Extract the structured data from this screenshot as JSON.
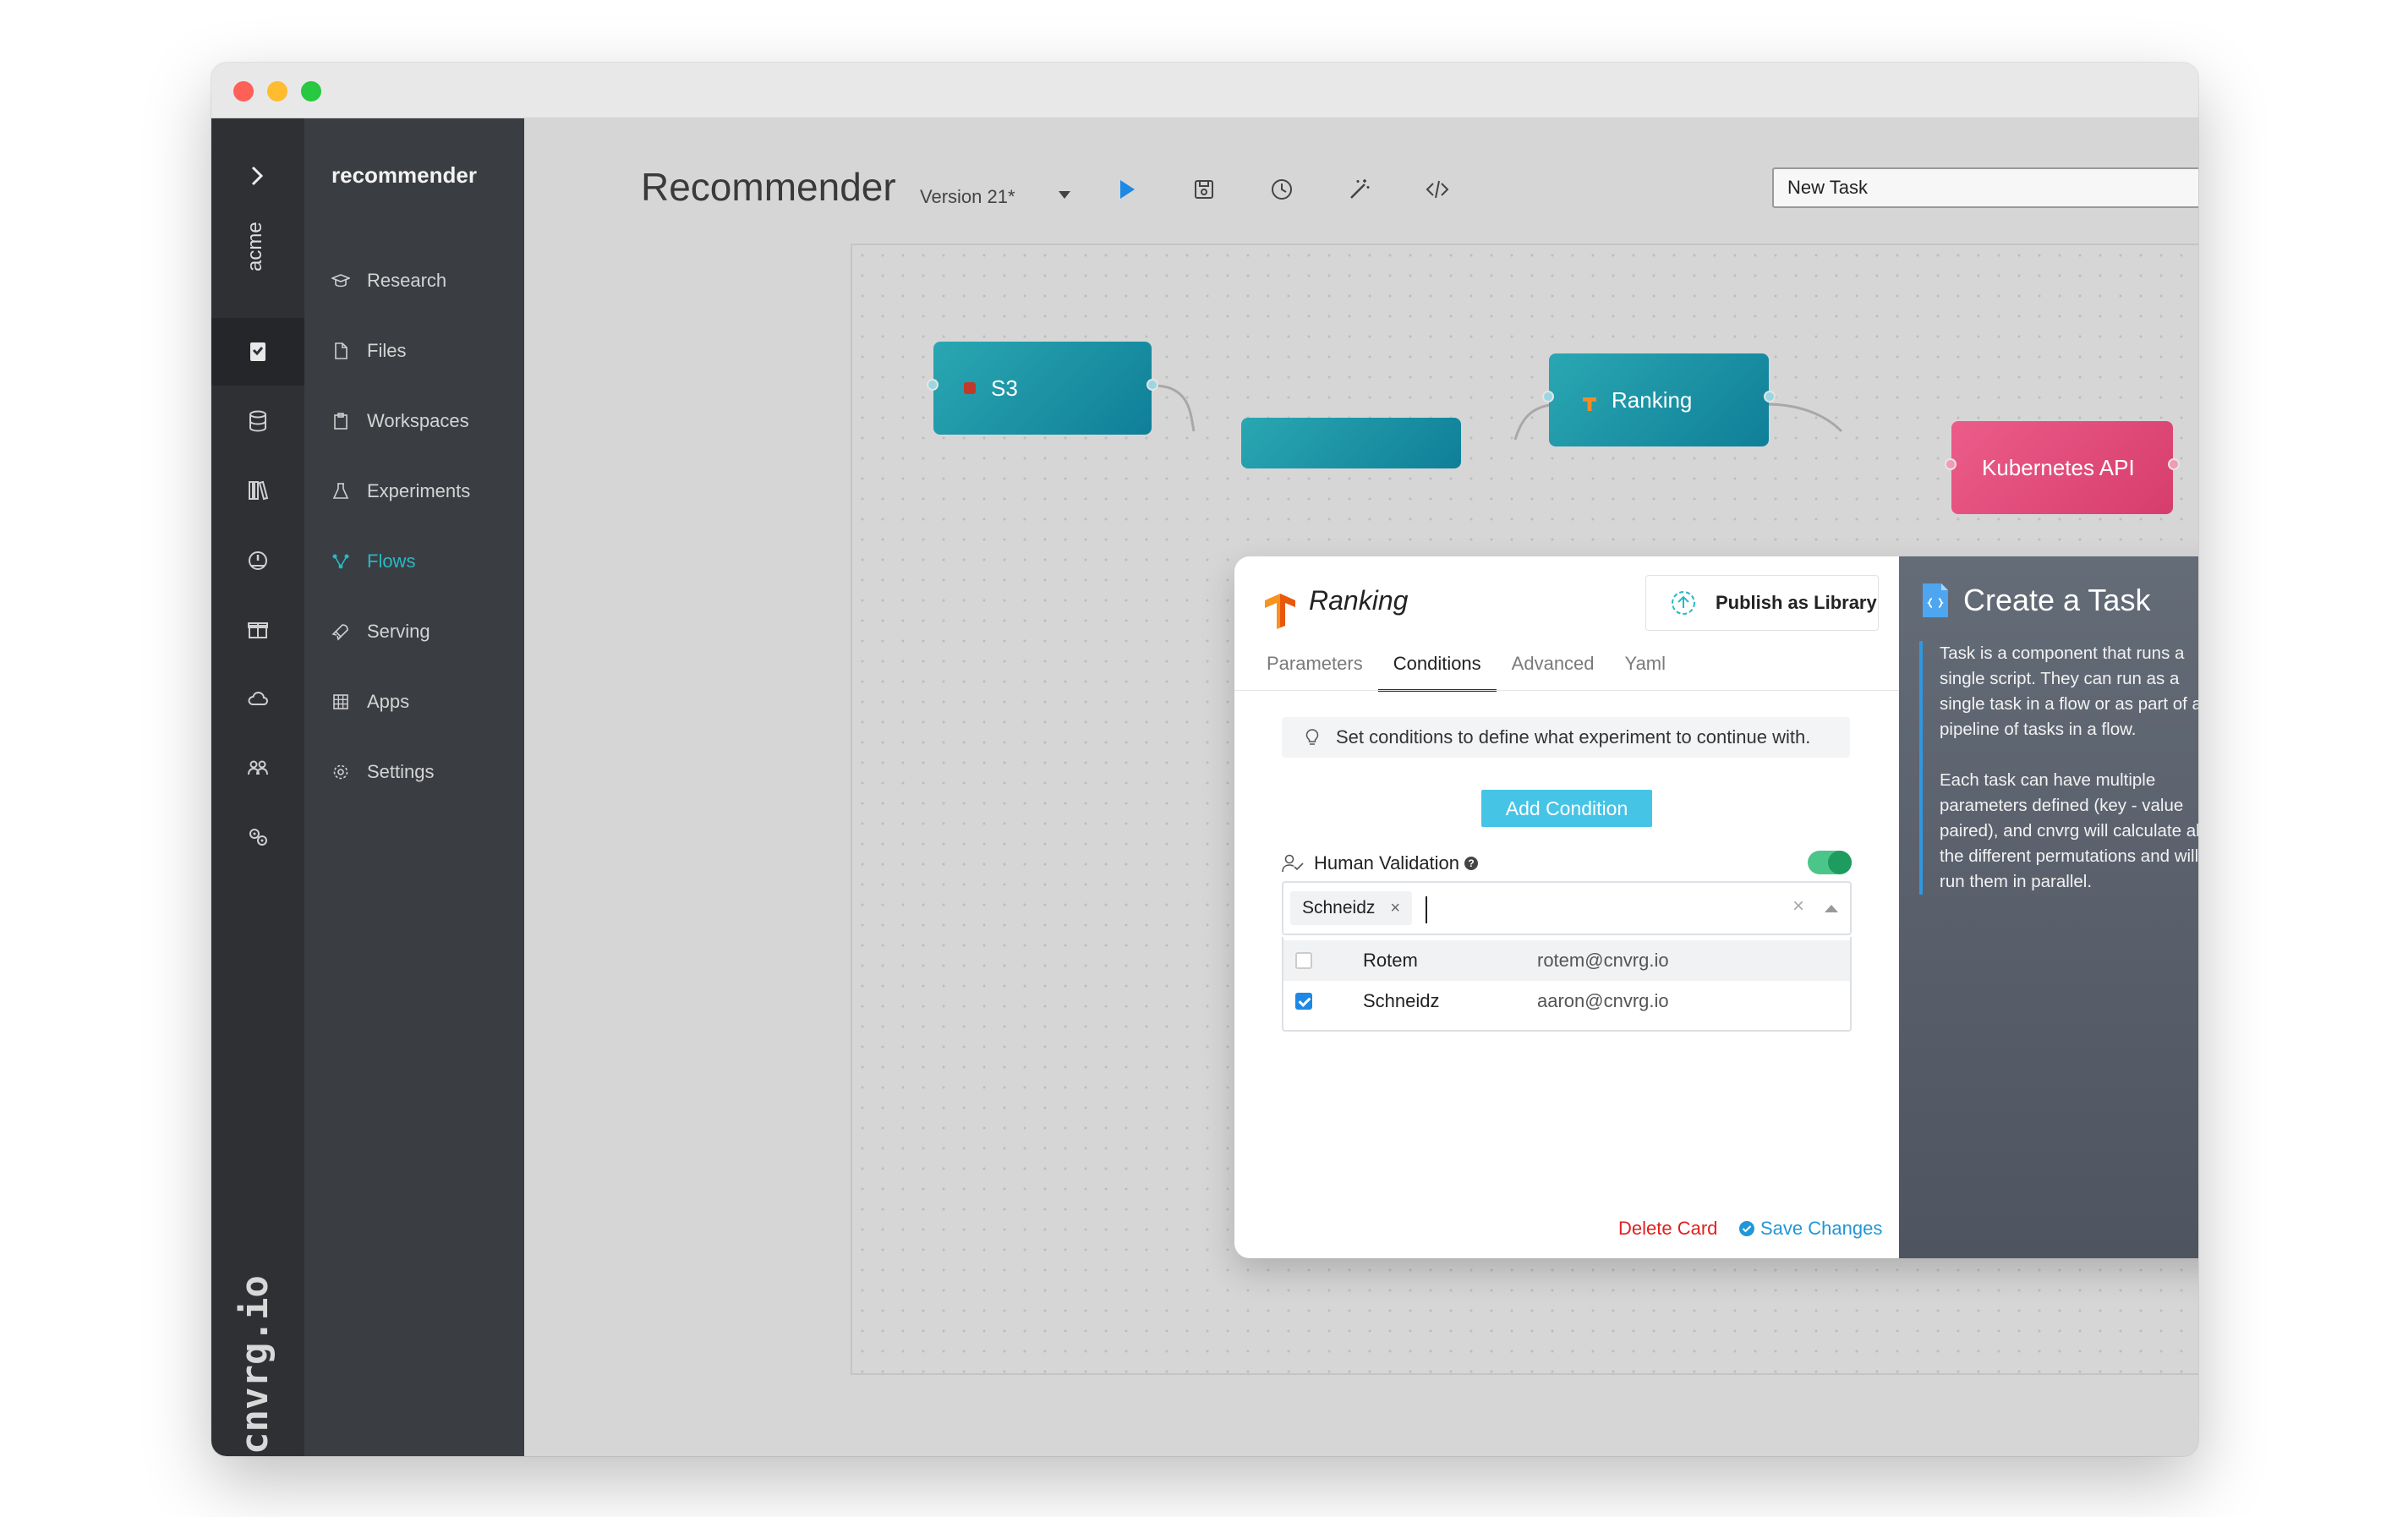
{
  "rail": {
    "org": "acme",
    "brand": "cnvrg.io"
  },
  "sidebar": {
    "project": "recommender",
    "items": [
      {
        "label": "Research",
        "icon": "graduation-cap-icon"
      },
      {
        "label": "Files",
        "icon": "file-icon"
      },
      {
        "label": "Workspaces",
        "icon": "clipboard-icon"
      },
      {
        "label": "Experiments",
        "icon": "flask-icon"
      },
      {
        "label": "Flows",
        "icon": "flows-icon",
        "active": true
      },
      {
        "label": "Serving",
        "icon": "rocket-icon"
      },
      {
        "label": "Apps",
        "icon": "grid-icon"
      },
      {
        "label": "Settings",
        "icon": "gear-icon"
      }
    ]
  },
  "header": {
    "title": "Recommender",
    "version": "Version 21*",
    "task_select": "New Task"
  },
  "canvas": {
    "nodes": {
      "s3": "S3",
      "ranking": "Ranking",
      "kubernetes": "Kubernetes API"
    }
  },
  "card": {
    "title": "Ranking",
    "publish_label": "Publish as Library",
    "tabs": [
      "Parameters",
      "Conditions",
      "Advanced",
      "Yaml"
    ],
    "active_tab": "Conditions",
    "hint": "Set conditions to define what experiment to continue with.",
    "add_condition": "Add Condition",
    "human_validation": {
      "label": "Human Validation",
      "enabled": true,
      "selected_chip": "Schneidz",
      "chip_remove": "×",
      "clear": "×",
      "options": [
        {
          "name": "Rotem",
          "email": "rotem@cnvrg.io",
          "checked": false
        },
        {
          "name": "Schneidz",
          "email": "aaron@cnvrg.io",
          "checked": true
        }
      ]
    },
    "delete_label": "Delete Card",
    "save_label": "Save Changes"
  },
  "help": {
    "title": "Create a Task",
    "paragraph1": "Task is a component that runs a single script. They can run as a single task in a flow or as part of a pipeline of tasks in a flow.",
    "paragraph2": "Each task can have multiple parameters defined (key - value paired), and cnvrg will calculate all the different permutations and will run them in parallel."
  },
  "colors": {
    "accent": "#28b8c4",
    "node_teal": "#1593a6",
    "node_pink": "#e04b7b",
    "add_condition": "#46c4e6",
    "delete": "#e02020",
    "save": "#2196d8"
  }
}
